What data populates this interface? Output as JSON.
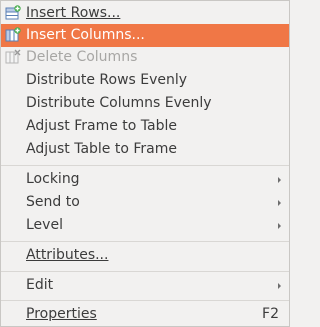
{
  "menu": {
    "items": [
      {
        "label": "Insert Rows...",
        "mnemonic_index": 0,
        "icon": "insert-rows-icon",
        "state": "normal"
      },
      {
        "label": "Insert Columns...",
        "mnemonic_index": 0,
        "icon": "insert-columns-icon",
        "state": "highlighted"
      },
      {
        "label": "Delete Columns",
        "mnemonic_index": 0,
        "icon": "delete-columns-icon",
        "state": "disabled"
      },
      {
        "label": "Distribute Rows Evenly",
        "state": "normal"
      },
      {
        "label": "Distribute Columns Evenly",
        "state": "normal"
      },
      {
        "label": "Adjust Frame to Table",
        "state": "normal"
      },
      {
        "label": "Adjust Table to Frame",
        "state": "normal"
      },
      {
        "label": "Locking",
        "state": "normal",
        "submenu": true
      },
      {
        "label": "Send to",
        "state": "normal",
        "submenu": true
      },
      {
        "label": "Level",
        "state": "normal",
        "submenu": true
      },
      {
        "label": "Attributes...",
        "state": "normal"
      },
      {
        "label": "Edit",
        "state": "normal",
        "submenu": true
      },
      {
        "label": "Properties",
        "state": "normal",
        "shortcut": "F2"
      }
    ]
  },
  "colors": {
    "highlight": "#f07746",
    "menu_bg": "#f2f1f0",
    "text": "#3c3c3c",
    "disabled_text": "#a7a6a4"
  }
}
